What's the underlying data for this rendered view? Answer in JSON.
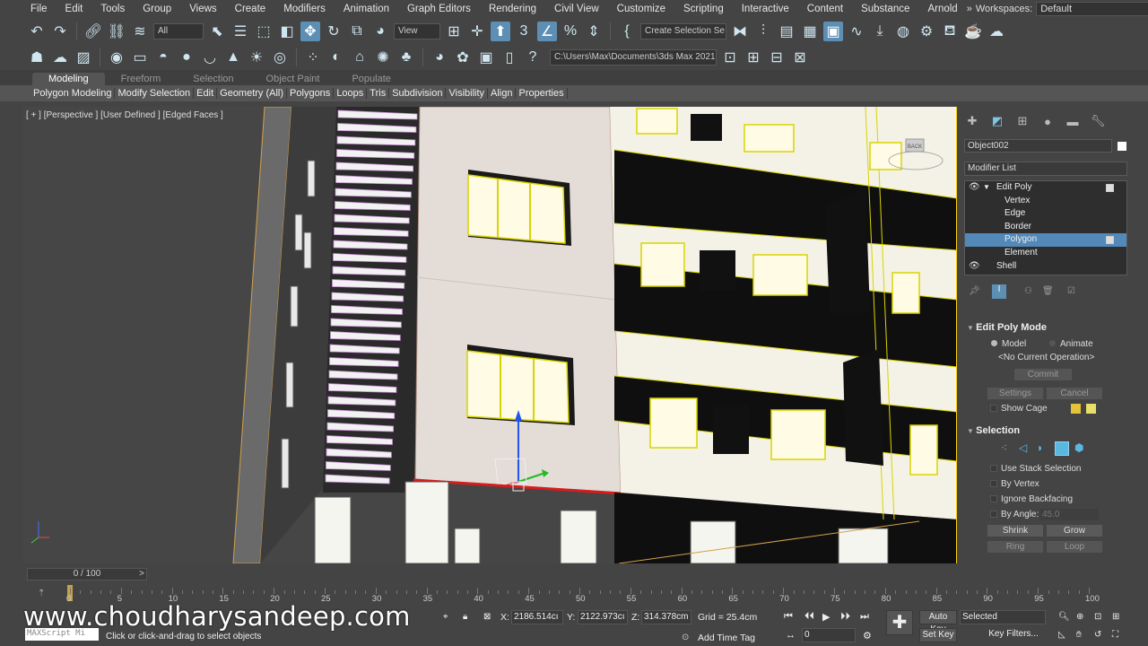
{
  "menu": [
    "File",
    "Edit",
    "Tools",
    "Group",
    "Views",
    "Create",
    "Modifiers",
    "Animation",
    "Graph Editors",
    "Rendering",
    "Civil View",
    "Customize",
    "Scripting",
    "Interactive",
    "Content",
    "Substance",
    "Arnold"
  ],
  "workspace": {
    "label": "Workspaces:",
    "value": "Default"
  },
  "toolbar1": {
    "filter": "All",
    "ref_coord": "View",
    "selection_set": "Create Selection Se"
  },
  "toolbar2": {
    "project_path": "C:\\Users\\Max\\Documents\\3ds Max 2021"
  },
  "ribbon": {
    "tabs": [
      "Modeling",
      "Freeform",
      "Selection",
      "Object Paint",
      "Populate"
    ],
    "panels": [
      "Polygon Modeling",
      "Modify Selection",
      "Edit",
      "Geometry (All)",
      "Polygons",
      "Loops",
      "Tris",
      "Subdivision",
      "Visibility",
      "Align",
      "Properties"
    ]
  },
  "viewport": {
    "label": "[ + ] [Perspective ] [User Defined ] [Edged Faces ]",
    "viewcube": "BACK"
  },
  "command_panel": {
    "object_name": "Object002",
    "modifier_list": "Modifier List",
    "stack": [
      {
        "label": "Edit Poly",
        "level": 0
      },
      {
        "label": "Vertex",
        "level": 1
      },
      {
        "label": "Edge",
        "level": 1
      },
      {
        "label": "Border",
        "level": 1
      },
      {
        "label": "Polygon",
        "level": 1,
        "selected": true
      },
      {
        "label": "Element",
        "level": 1
      },
      {
        "label": "Shell",
        "level": 0
      }
    ],
    "edit_poly_mode": {
      "title": "Edit Poly Mode",
      "model": "Model",
      "animate": "Animate",
      "no_op": "<No Current Operation>",
      "commit": "Commit",
      "settings": "Settings",
      "cancel": "Cancel",
      "show_cage": "Show Cage"
    },
    "selection": {
      "title": "Selection",
      "use_stack": "Use Stack Selection",
      "by_vertex": "By Vertex",
      "ignore_backfacing": "Ignore Backfacing",
      "by_angle": "By Angle:",
      "angle_value": "45.0",
      "shrink": "Shrink",
      "grow": "Grow",
      "ring": "Ring",
      "loop": "Loop"
    }
  },
  "timeline": {
    "frame": "0 / 100",
    "ticks": [
      "0",
      "5",
      "10",
      "15",
      "20",
      "25",
      "30",
      "35",
      "40",
      "45",
      "50",
      "55",
      "60",
      "65",
      "70",
      "75",
      "80",
      "85",
      "90",
      "95",
      "100"
    ]
  },
  "status": {
    "watermark": "www.choudharysandeep.com",
    "maxscript": "MAXScript Mi",
    "prompt": "Click or click-and-drag to select objects",
    "x_label": "X:",
    "x": "2186.514cı",
    "y_label": "Y:",
    "y": "2122.973cı",
    "z_label": "Z:",
    "z": "314.378cm",
    "grid": "Grid = 25.4cm",
    "add_time_tag": "Add Time Tag",
    "auto_key": "Auto Key",
    "set_key": "Set Key",
    "key_mode": "Selected",
    "key_filters": "Key Filters...",
    "frame_field": "0"
  }
}
